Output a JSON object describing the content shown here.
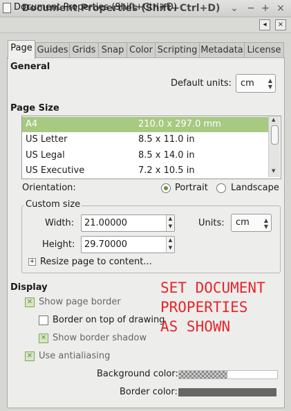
{
  "window": {
    "title": "Document Properties (Shift+Ctrl+D)",
    "buttons": [
      "⌄",
      "−",
      "+",
      "×"
    ]
  },
  "dock": {
    "title": "Document Properties (Shift+Ctrl+D)"
  },
  "tabs": [
    {
      "label": "Page"
    },
    {
      "label": "Guides"
    },
    {
      "label": "Grids"
    },
    {
      "label": "Snap"
    },
    {
      "label": "Color"
    },
    {
      "label": "Scripting"
    },
    {
      "label": "Metadata"
    },
    {
      "label": "License"
    }
  ],
  "general": {
    "heading": "General",
    "default_units_label": "Default units:",
    "default_units_value": "cm"
  },
  "page_size": {
    "heading": "Page Size",
    "rows": [
      {
        "name": "A4",
        "size": "210.0 x 297.0 mm",
        "selected": true
      },
      {
        "name": "US Letter",
        "size": "8.5 x 11.0 in",
        "selected": false
      },
      {
        "name": "US Legal",
        "size": "8.5 x 14.0 in",
        "selected": false
      },
      {
        "name": "US Executive",
        "size": "7.2 x 10.5 in",
        "selected": false
      }
    ]
  },
  "orientation": {
    "label": "Orientation:",
    "portrait": "Portrait",
    "landscape": "Landscape",
    "selected": "portrait"
  },
  "custom_size": {
    "legend": "Custom size",
    "width_label": "Width:",
    "width_value": "21.00000",
    "height_label": "Height:",
    "height_value": "29.70000",
    "units_label": "Units:",
    "units_value": "cm",
    "resize_label": "Resize page to content..."
  },
  "display": {
    "heading": "Display",
    "show_page_border": {
      "label": "Show page border",
      "checked": true
    },
    "border_on_top": {
      "label": "Border on top of drawing",
      "checked": false
    },
    "show_border_shadow": {
      "label": "Show border shadow",
      "checked": true
    },
    "use_antialiasing": {
      "label": "Use antialiasing",
      "checked": true
    },
    "background_color_label": "Background color:",
    "border_color_label": "Border color:",
    "border_color": "#666666"
  },
  "annotation": {
    "lines": [
      "SET DOCUMENT",
      "PROPERTIES",
      "AS SHOWN"
    ]
  },
  "colors": {
    "accent_selection": "#a7c982",
    "annotation": "#e3262d"
  }
}
